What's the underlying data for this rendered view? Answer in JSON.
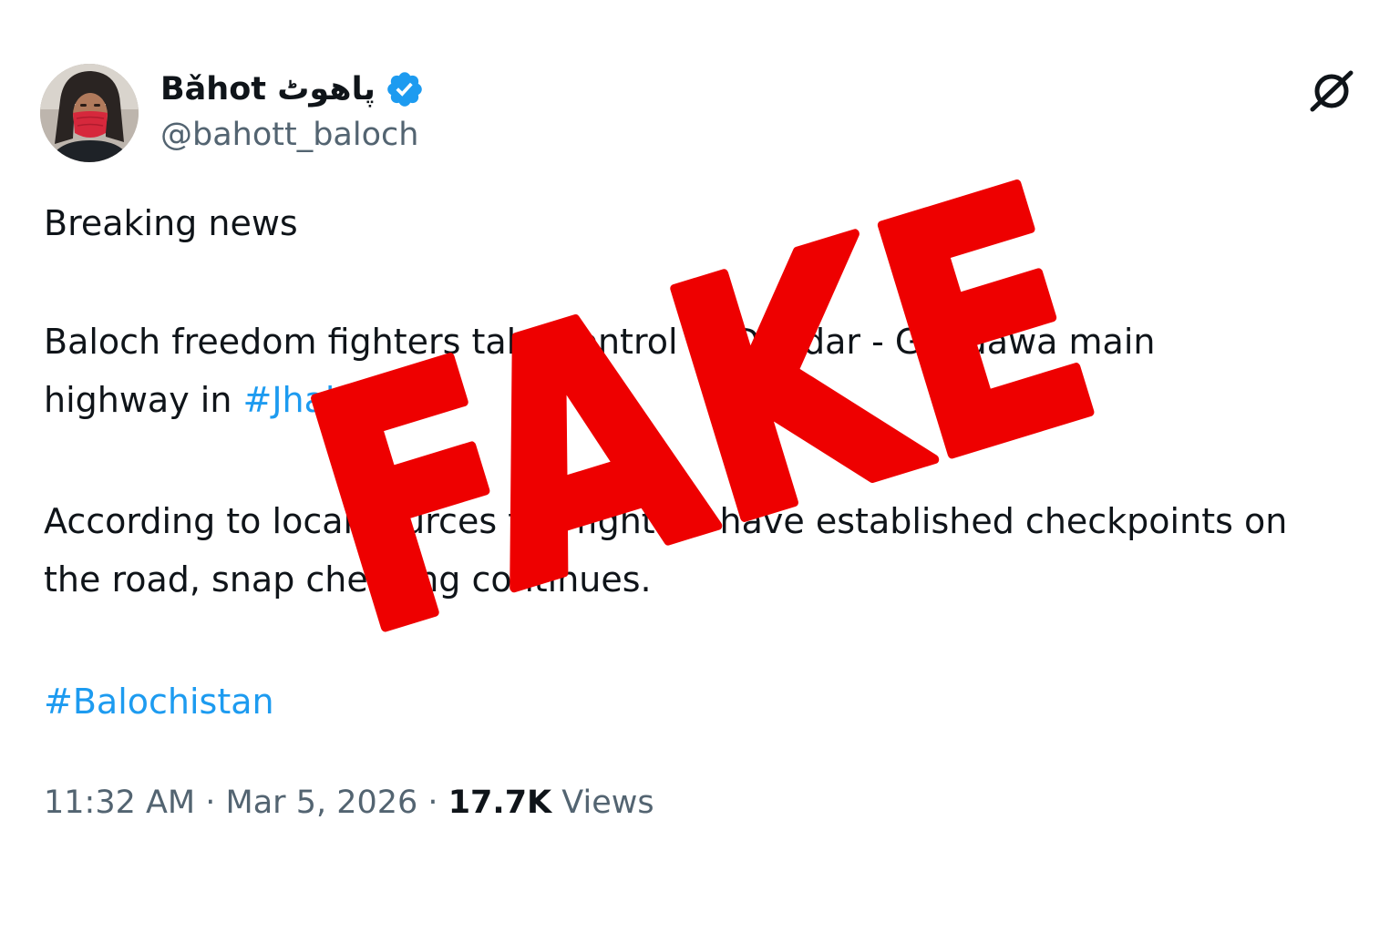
{
  "author": {
    "display_name": "Bǎhot پاهوٹ",
    "handle": "@bahott_baloch",
    "verified": true,
    "avatar": "avatar-person-red-mask"
  },
  "icons": {
    "verified": "verified-badge-icon",
    "grok": "grok-icon"
  },
  "tweet": {
    "line1": "Breaking news",
    "p2_line1": "Baloch freedom fighters take control of Dhadar - Gandawa main",
    "p2_line2_prefix": "highway in ",
    "p2_hashtag": "#Jhal",
    "p3_line1": "According to local sources the fighters have established checkpoints on",
    "p3_line2": "the road, snap checking continues.",
    "hashtag_footer": "#Balochistan"
  },
  "meta": {
    "time": "11:32 AM",
    "separator": " · ",
    "date": "Mar 5, 2026",
    "views_count": "17.7K",
    "views_label": " Views"
  },
  "stamp": {
    "text": "FAKE",
    "color": "#ee0000"
  },
  "colors": {
    "text": "#0f1419",
    "secondary": "#536471",
    "link": "#1d9bf0",
    "verified": "#1d9bf0"
  }
}
